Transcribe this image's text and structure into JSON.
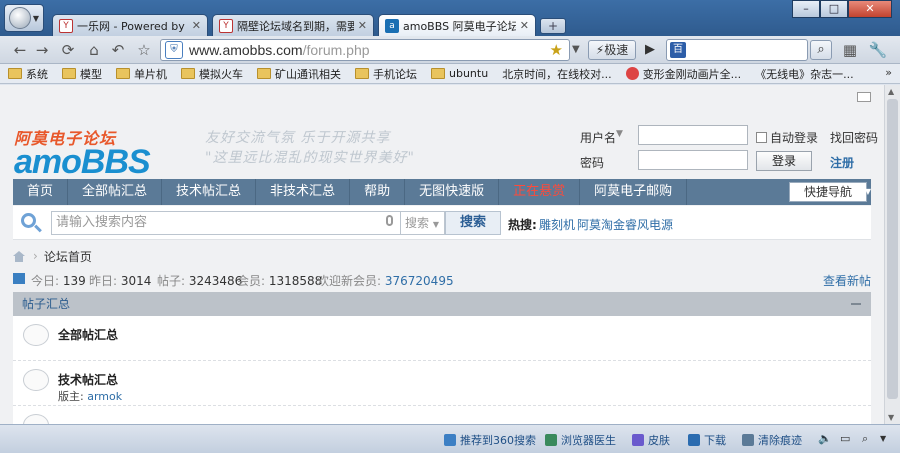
{
  "browser": {
    "tabs": [
      {
        "title": "一乐网 - Powered by Dis",
        "fav": "Y"
      },
      {
        "title": "隔壁论坛域名到期，需要选",
        "fav": "Y"
      },
      {
        "title": "amoBBS 阿莫电子论坛 首页",
        "fav": "a"
      }
    ],
    "new_tab": "+",
    "window_controls": [
      "–",
      "□",
      "✕"
    ],
    "url_host": "www.amobbs.com",
    "url_path": "/forum.php",
    "speed_label": "⚡极速",
    "search_value": ""
  },
  "bookmarks": [
    {
      "label": "系统",
      "kind": "folder"
    },
    {
      "label": "模型",
      "kind": "folder"
    },
    {
      "label": "单片机",
      "kind": "folder"
    },
    {
      "label": "模拟火车",
      "kind": "folder"
    },
    {
      "label": "矿山通讯相关",
      "kind": "folder"
    },
    {
      "label": "手机论坛",
      "kind": "folder"
    },
    {
      "label": "ubuntu",
      "kind": "folder"
    },
    {
      "label": "北京时间，在线校对...",
      "kind": "page"
    },
    {
      "label": "变形金刚动画片全...",
      "kind": "favicon"
    },
    {
      "label": "《无线电》杂志一...",
      "kind": "page"
    }
  ],
  "bookmarks_more": "»",
  "site": {
    "logo_cn": "阿莫电子论坛",
    "logo_en": "amoBBS",
    "slogan_line1": "友好交流气氛 乐于开源共享",
    "slogan_line2": "\"这里远比混乱的现实世界美好\""
  },
  "login": {
    "username_label": "用户名",
    "password_label": "密码",
    "remember_label": "自动登录",
    "login_button": "登录",
    "find_password": "找回密码",
    "register": "注册"
  },
  "mainnav": {
    "items": [
      "首页",
      "全部帖汇总",
      "技术帖汇总",
      "非技术汇总",
      "帮助",
      "无图快速版",
      "正在悬赏",
      "阿莫电子邮购"
    ],
    "quick_nav": "快捷导航"
  },
  "search": {
    "placeholder": "请输入搜索内容",
    "type_label": "搜索",
    "button": "搜索",
    "hot_label": "热搜:",
    "hot_words": [
      "雕刻机",
      "阿莫淘金",
      "睿风电源"
    ]
  },
  "breadcrumb": {
    "current": "论坛首页"
  },
  "stats": {
    "today_label": "今日:",
    "today_value": "139",
    "yesterday_label": "昨日:",
    "yesterday_value": "3014",
    "posts_label": "帖子:",
    "posts_value": "3243486",
    "members_label": "会员:",
    "members_value": "1318588",
    "welcome_label": "欢迎新会员:",
    "welcome_user": "376720495",
    "view_new": "查看新帖"
  },
  "section": {
    "title": "帖子汇总",
    "forums": [
      {
        "name": "全部帖汇总",
        "mod_label": "",
        "mod_name": ""
      },
      {
        "name": "技术帖汇总",
        "mod_label": "版主:",
        "mod_name": "armok"
      }
    ]
  },
  "statusbar": {
    "items": [
      "推荐到360搜索",
      "浏览器医生",
      "皮肤",
      "下载",
      "清除痕迹"
    ]
  },
  "colors": {
    "nav_bg": "#5b7a97",
    "hot_red": "#ff4a3a",
    "link_blue": "#2f6ea7",
    "logo_blue": "#1a8fd0",
    "logo_orange": "#e8582b"
  }
}
